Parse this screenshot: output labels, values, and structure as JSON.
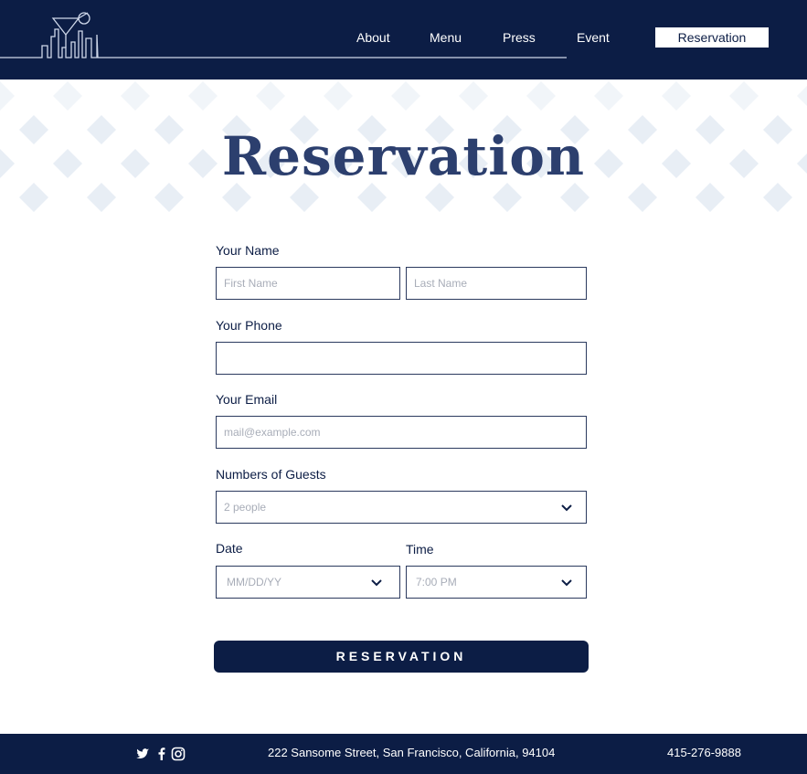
{
  "header": {
    "nav": {
      "about": "About",
      "menu": "Menu",
      "press": "Press",
      "event": "Event",
      "reservation": "Reservation"
    }
  },
  "hero": {
    "title": "Reservation"
  },
  "form": {
    "name_label": "Your Name",
    "first_name_placeholder": "First Name",
    "last_name_placeholder": "Last Name",
    "phone_label": "Your Phone",
    "phone_value": "",
    "email_label": "Your Email",
    "email_placeholder": "mail@example.com",
    "guests_label": "Numbers of Guests",
    "guests_value": "2 people",
    "date_label": "Date",
    "date_value": "MM/DD/YY",
    "time_label": "Time",
    "time_value": "7:00 PM",
    "submit_label": "RESERVATION"
  },
  "footer": {
    "icons": [
      "twitter-icon",
      "facebook-icon",
      "instagram-icon"
    ],
    "address": "222 Sansome Street, San Francisco, California, 94104",
    "phone": "415-276-9888"
  },
  "colors": {
    "navy": "#0c1d45",
    "title": "#2c3f6e",
    "pattern": "#e8eef5"
  }
}
